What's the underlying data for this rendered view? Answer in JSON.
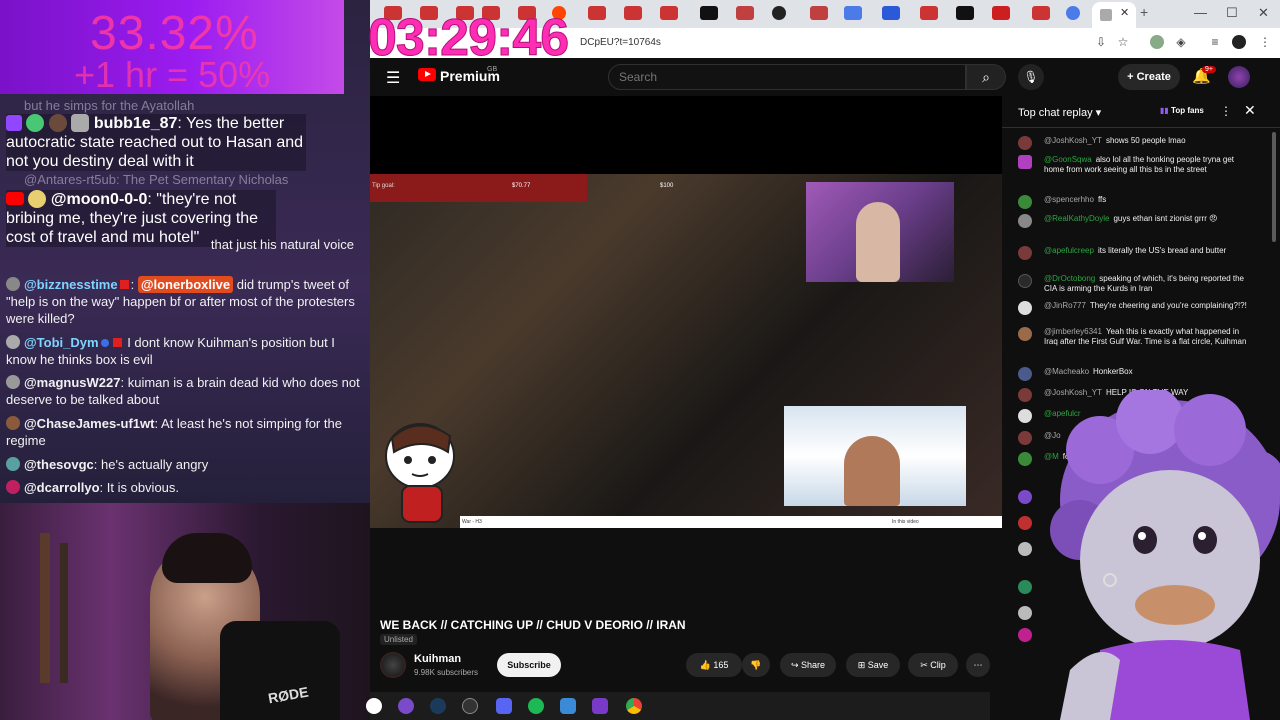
{
  "overlay": {
    "goal_percent": "33.32%",
    "goal_sub": "+1 hr = 50%",
    "timer": "03:29:46"
  },
  "stream_chat": {
    "ghost_lines": [
      "but he simps for the Ayatollah",
      "@Antares-rt5ub: The Pet Sementary Nicholas"
    ],
    "big_messages": [
      {
        "user": "bubb1e_87",
        "text": "Yes the better autocratic state reached out to Hasan and not you destiny deal with it"
      },
      {
        "user": "@moon0-0-0",
        "text": "\"they're not bribing me, they're just covering the cost of travel and mu hotel\""
      }
    ],
    "messages": [
      {
        "user": "",
        "text": "that just his natural voice"
      },
      {
        "user": "@bizznesstime",
        "tag": "@lonerboxlive",
        "text": "did trump's tweet of \"help is on the way\" happen bf or after most of the protesters were killed?"
      },
      {
        "user": "@Tobi_Dym",
        "text": "I dont know Kuihman's position but I know he thinks box is evil"
      },
      {
        "user": "@magnusW227",
        "text": "kuiman is a brain dead kid who does not deserve to be talked about"
      },
      {
        "user": "@ChaseJames-uf1wt",
        "text": "At least he's not simping for the regime"
      },
      {
        "user": "@thesovgc",
        "text": "he's actually angry"
      },
      {
        "user": "@dcarrollyo",
        "text": "It is obvious."
      }
    ],
    "cam_label": "RØDE"
  },
  "browser": {
    "url": "DCpEU?t=10764s",
    "window_controls": [
      "—",
      "☐",
      "✕"
    ]
  },
  "youtube": {
    "brand": "Premium",
    "region": "GB",
    "search_placeholder": "Search",
    "create_label": "Create",
    "notif_count": "9+",
    "video": {
      "tip_goal_label": "Tip goal:",
      "tip_value": "$70.77",
      "tip_max": "$100",
      "strip_left": "War - H3",
      "strip_right": "In this video"
    },
    "title": "WE BACK // CATCHING UP // CHUD V DEORIO // IRAN",
    "visibility": "Unlisted",
    "channel": "Kuihman",
    "subscribers": "9.98K subscribers",
    "subscribe_label": "Subscribe",
    "likes": "165",
    "share_label": "Share",
    "save_label": "Save",
    "clip_label": "Clip"
  },
  "chat_replay": {
    "title": "Top chat replay",
    "top_fans_label": "Top fans",
    "messages": [
      {
        "user": "@JoshKosh_YT",
        "text": "shows 50 people lmao",
        "color": "#7a3a3a"
      },
      {
        "user": "@GoonSqwa",
        "member": true,
        "text": "also lol all the honking people tryna get home from work seeing all this bs in the street",
        "color": "#b040c0"
      },
      {
        "user": "@spencerhho",
        "text": "ffs",
        "color": "#3a8a3a"
      },
      {
        "user": "@RealKathyDoyle",
        "member": true,
        "text": "guys ethan isnt zionist grrr 😠",
        "color": "#888888"
      },
      {
        "user": "@apefulcreep",
        "member": true,
        "text": "its literally the US's bread and butter",
        "color": "#7a3a3a"
      },
      {
        "user": "@DrOctobong",
        "member": true,
        "text": "speaking of which, it's being reported the CIA is arming the Kurds in Iran",
        "color": "#2a2a2a"
      },
      {
        "user": "@JinRo777",
        "text": "They're cheering and you're complaining?!?!",
        "color": "#dddddd"
      },
      {
        "user": "@jimberley6341",
        "text": "Yeah this is exactly what happened in Iraq after the First Gulf War. Time is a flat circle, Kuihman",
        "color": "#9a6a4a"
      },
      {
        "user": "@Macheako",
        "text": "HonkerBox",
        "color": "#4a5a8a"
      },
      {
        "user": "@JoshKosh_YT",
        "text": "HELP IS ON THE WAY",
        "color": "#7a3a3a"
      },
      {
        "user": "@apefulcr",
        "member": true,
        "text": "",
        "color": "#dddddd"
      },
      {
        "user": "@Jo",
        "text": "",
        "color": "#7a3a3a"
      },
      {
        "user": "@M",
        "member": true,
        "text": "fo Isra",
        "color": "#3a8a3a"
      }
    ]
  },
  "taskbar": {
    "icons": [
      "windows-icon",
      "app-icon",
      "steam-icon",
      "obs-icon",
      "discord-icon",
      "spotify-icon",
      "app2-icon",
      "app3-icon",
      "chrome-icon"
    ]
  }
}
